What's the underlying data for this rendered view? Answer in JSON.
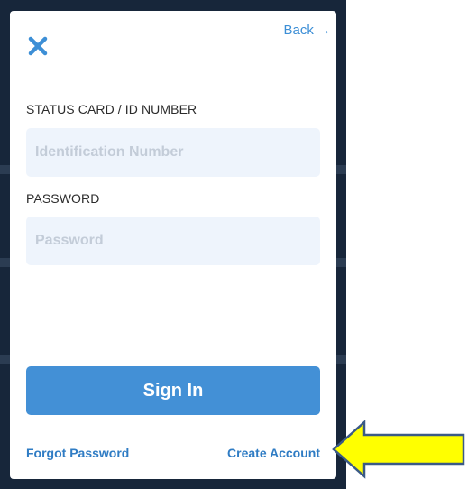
{
  "header": {
    "close_icon": "close-x-icon",
    "back_label": "Back →"
  },
  "form": {
    "id_label": "STATUS CARD / ID NUMBER",
    "id_placeholder": "Identification Number",
    "id_value": "",
    "password_label": "PASSWORD",
    "password_placeholder": "Password",
    "password_value": ""
  },
  "actions": {
    "sign_in_label": "Sign In",
    "forgot_password_label": "Forgot Password",
    "create_account_label": "Create Account"
  },
  "annotation": {
    "arrow_icon": "yellow-left-arrow-icon",
    "arrow_fill": "#ffff00",
    "arrow_stroke": "#3b5a86"
  },
  "colors": {
    "accent": "#4390d6",
    "link": "#2f7cc4",
    "input_bg": "#eef4fc",
    "backdrop": "#17263a"
  }
}
